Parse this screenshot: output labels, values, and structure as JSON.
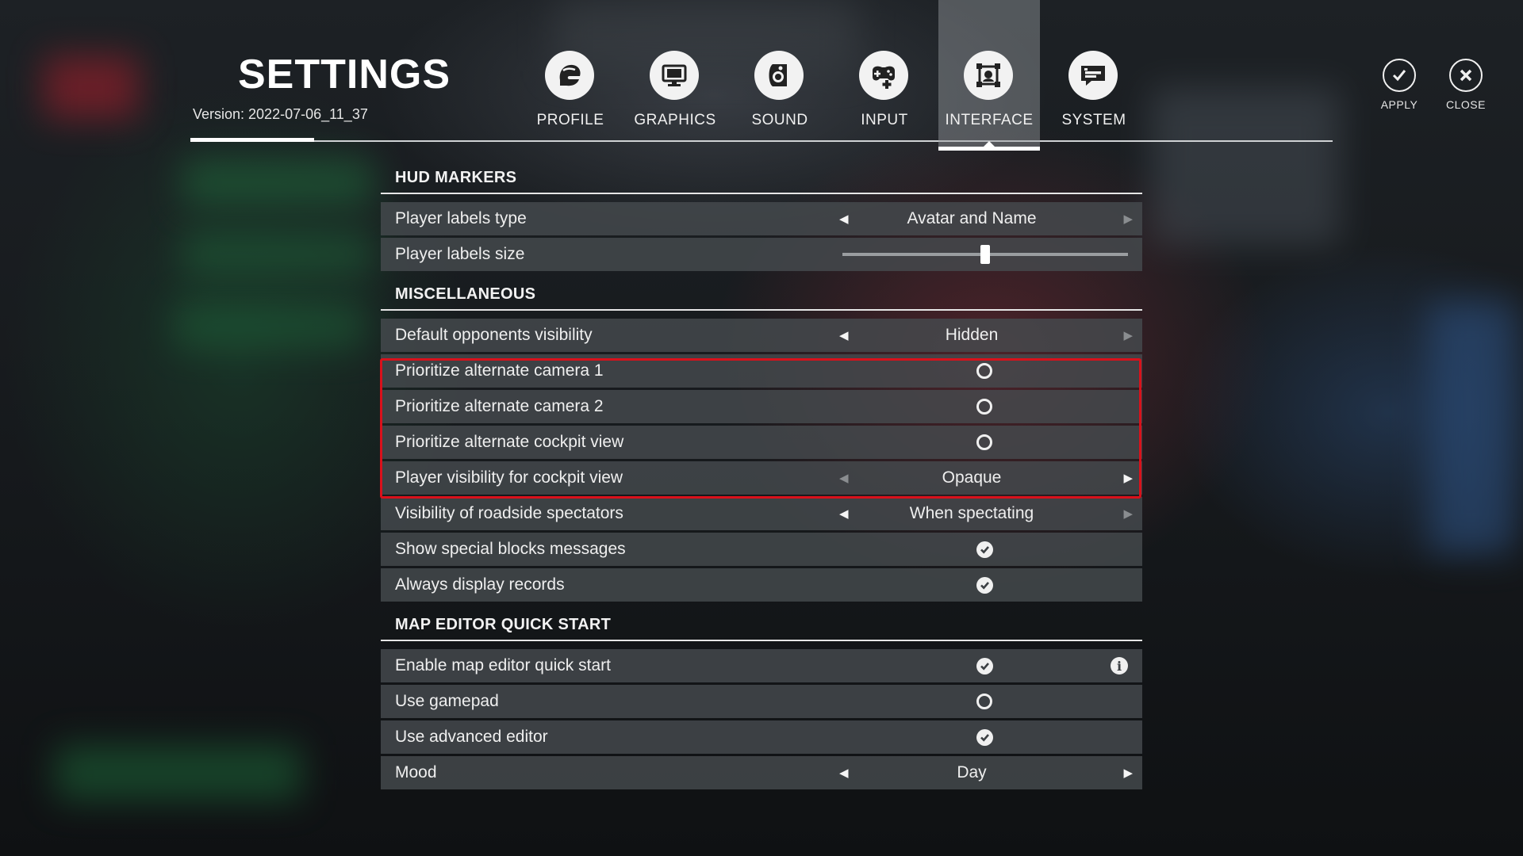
{
  "header": {
    "title": "SETTINGS",
    "version": "Version: 2022-07-06_11_37"
  },
  "tabs": [
    {
      "label": "PROFILE",
      "icon": "helmet-icon"
    },
    {
      "label": "GRAPHICS",
      "icon": "monitor-icon"
    },
    {
      "label": "SOUND",
      "icon": "speaker-icon"
    },
    {
      "label": "INPUT",
      "icon": "gamepad-icon"
    },
    {
      "label": "INTERFACE",
      "icon": "interface-icon",
      "active": true
    },
    {
      "label": "SYSTEM",
      "icon": "chat-icon"
    }
  ],
  "actions": {
    "apply": "APPLY",
    "close": "CLOSE"
  },
  "sections": {
    "hud": {
      "title": "HUD MARKERS",
      "player_labels_type": {
        "label": "Player labels type",
        "value": "Avatar and Name"
      },
      "player_labels_size": {
        "label": "Player labels size",
        "level": 0.5
      }
    },
    "misc": {
      "title": "MISCELLANEOUS",
      "default_opponents_visibility": {
        "label": "Default opponents visibility",
        "value": "Hidden"
      },
      "alt_camera_1": {
        "label": "Prioritize alternate camera 1",
        "checked": false
      },
      "alt_camera_2": {
        "label": "Prioritize alternate camera 2",
        "checked": false
      },
      "alt_cockpit": {
        "label": "Prioritize alternate cockpit view",
        "checked": false
      },
      "cockpit_visibility": {
        "label": "Player visibility for cockpit view",
        "value": "Opaque"
      },
      "roadside_spectators": {
        "label": "Visibility of roadside spectators",
        "value": "When spectating"
      },
      "special_blocks": {
        "label": "Show special blocks messages",
        "checked": true
      },
      "display_records": {
        "label": "Always display records",
        "checked": true
      }
    },
    "map_editor": {
      "title": "MAP EDITOR QUICK START",
      "quick_start": {
        "label": "Enable map editor quick start",
        "checked": true
      },
      "gamepad": {
        "label": "Use gamepad",
        "checked": false
      },
      "advanced_editor": {
        "label": "Use advanced editor",
        "checked": true
      },
      "mood": {
        "label": "Mood",
        "value": "Day"
      }
    }
  },
  "colors": {
    "highlight": "#d9111b",
    "row_bg": "#464a4e"
  }
}
